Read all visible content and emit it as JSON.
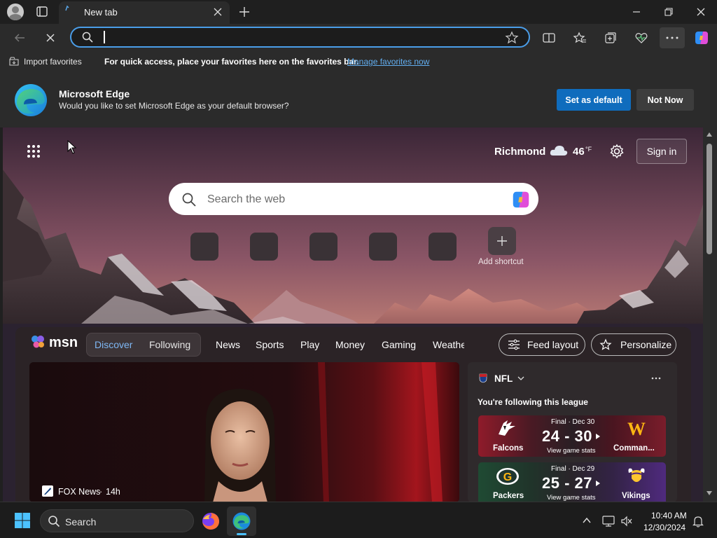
{
  "tab": {
    "title": "New tab"
  },
  "address_bar": {
    "value": "",
    "placeholder": ""
  },
  "favorites_bar": {
    "import_label": "Import favorites",
    "message": "For quick access, place your favorites here on the favorites bar.",
    "manage_link": "Manage favorites now"
  },
  "default_prompt": {
    "title": "Microsoft Edge",
    "message": "Would you like to set Microsoft Edge as your default browser?",
    "set_default": "Set as default",
    "not_now": "Not Now"
  },
  "ntp": {
    "weather": {
      "city": "Richmond",
      "temp": "46",
      "unit": "°F"
    },
    "sign_in": "Sign in",
    "search_placeholder": "Search the web",
    "add_shortcut": "Add shortcut"
  },
  "feed": {
    "brand": "msn",
    "tabs": [
      "Discover",
      "Following",
      "News",
      "Sports",
      "Play",
      "Money",
      "Gaming",
      "Weathe"
    ],
    "feed_layout": "Feed layout",
    "personalize": "Personalize",
    "hero": {
      "source": "FOX News",
      "age": "14h"
    },
    "nfl": {
      "title": "NFL",
      "subtitle": "You're following this league",
      "games": [
        {
          "status": "Final · Dec 30",
          "score": "24 - 30",
          "stats": "View game stats",
          "home": "Falcons",
          "away": "Comman..."
        },
        {
          "status": "Final · Dec 29",
          "score": "25 - 27",
          "stats": "View game stats",
          "home": "Packers",
          "away": "Vikings"
        }
      ]
    }
  },
  "taskbar": {
    "search": "Search",
    "time": "10:40 AM",
    "date": "12/30/2024"
  },
  "colors": {
    "accent": "#0f6cbd",
    "link": "#62aef0",
    "address_border": "#4a9de8"
  }
}
